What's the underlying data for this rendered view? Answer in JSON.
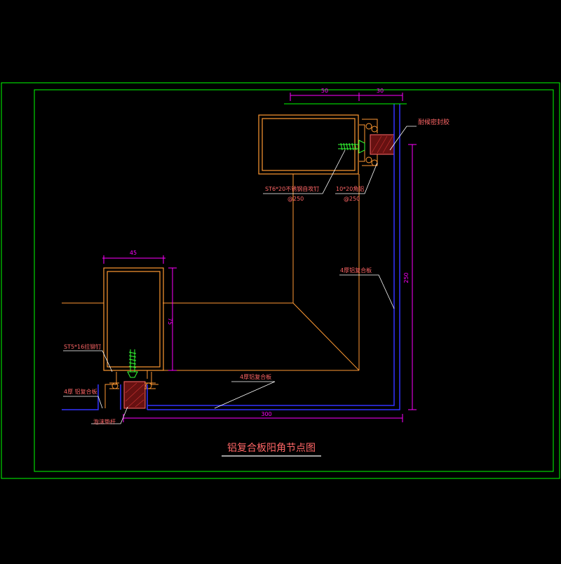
{
  "title": "铝复合板阳角节点图",
  "dimensions": {
    "top_width_a": "50",
    "top_width_b": "30",
    "left_width": "45",
    "left_height": "75",
    "right_height": "250",
    "bottom_width": "300"
  },
  "labels": {
    "sealant": "耐候密封胶",
    "screw_top": "ST6*20不锈钢自攻钉",
    "screw_top_spacing": "@250",
    "angle_code": "10*20角铝",
    "angle_spacing": "@250",
    "panel_right": "4厚铝复合板",
    "panel_bottom": "4厚铝复合板",
    "panel_left": "4厚 铝复合板",
    "screw_left": "ST5*16拉铆钉",
    "foam_rod": "泡沫垫杆"
  },
  "colors": {
    "background": "#000000",
    "frame": "#00ff00",
    "dimension": "#ff00ff",
    "steel": "#ff9933",
    "panel": "#3333ff",
    "annotation": "#ff6666",
    "screw": "#33ff33",
    "sealant_fill": "#661111",
    "title_underline": "#ffffff"
  }
}
